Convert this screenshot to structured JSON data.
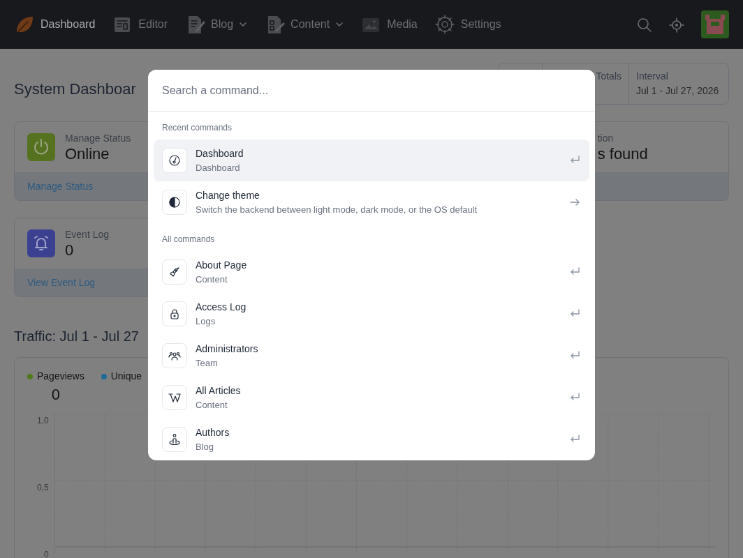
{
  "navbar": {
    "items": [
      {
        "label": "Dashboard",
        "selected": true,
        "dropdown": false
      },
      {
        "label": "Editor",
        "selected": false,
        "dropdown": false
      },
      {
        "label": "Blog",
        "selected": false,
        "dropdown": true
      },
      {
        "label": "Content",
        "selected": false,
        "dropdown": true
      },
      {
        "label": "Media",
        "selected": false,
        "dropdown": false
      },
      {
        "label": "Settings",
        "selected": false,
        "dropdown": false
      }
    ]
  },
  "page": {
    "title": "System Dashboar",
    "summary": [
      {
        "label": "Totals"
      },
      {
        "label": "Interval",
        "value": "Jul 1 - Jul 27, 2026"
      }
    ],
    "cards": [
      {
        "label": "Manage Status",
        "value": "Online",
        "link": "Manage Status",
        "color": "#56711f"
      },
      {
        "label": "tion",
        "value": "s found"
      },
      {
        "label": "Event Log",
        "value": "0",
        "link": "View Event Log",
        "color": "#3c4091"
      }
    ],
    "traffic_title": "Traffic: Jul 1 - Jul 27",
    "legend": [
      {
        "label": "Pageviews",
        "color": "#4f7a1a",
        "value": "0"
      },
      {
        "label": "Unique",
        "color": "#1e6a99"
      }
    ],
    "axis_labels": [
      "1,0",
      "0,5",
      "0"
    ]
  },
  "palette": {
    "placeholder": "Search a command...",
    "sections": [
      {
        "title": "Recent commands",
        "items": [
          {
            "title": "Dashboard",
            "subtitle": "Dashboard",
            "kind": "open",
            "selected": true
          },
          {
            "title": "Change theme",
            "subtitle": "Switch the backend between light mode, dark mode, or the OS default",
            "kind": "navigate",
            "selected": false
          }
        ]
      },
      {
        "title": "All commands",
        "items": [
          {
            "title": "About Page",
            "subtitle": "Content",
            "kind": "open",
            "selected": false
          },
          {
            "title": "Access Log",
            "subtitle": "Logs",
            "kind": "open",
            "selected": false
          },
          {
            "title": "Administrators",
            "subtitle": "Team",
            "kind": "open",
            "selected": false
          },
          {
            "title": "All Articles",
            "subtitle": "Content",
            "kind": "open",
            "selected": false
          },
          {
            "title": "Authors",
            "subtitle": "Blog",
            "kind": "open",
            "selected": false
          }
        ]
      }
    ]
  }
}
